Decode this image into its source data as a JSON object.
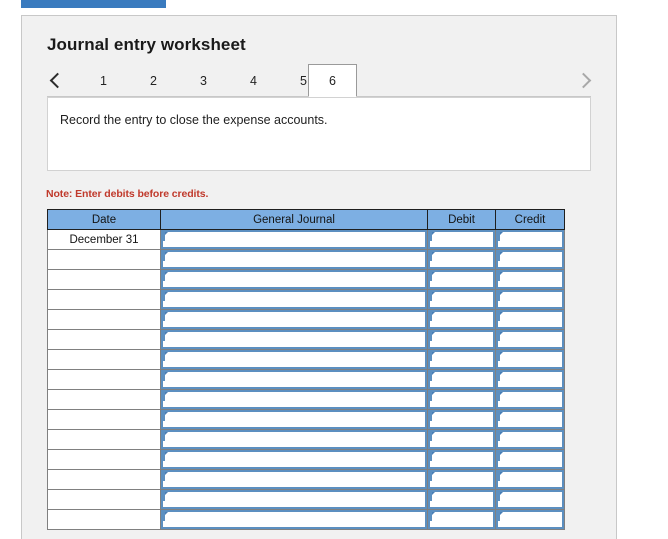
{
  "top_bar": {
    "color": "#3A7BBF"
  },
  "panel": {
    "title": "Journal entry worksheet",
    "bg": "#f1f1f1"
  },
  "tabs": {
    "prev_label": "previous",
    "next_label": "next",
    "items": [
      {
        "label": "1",
        "selected": false
      },
      {
        "label": "2",
        "selected": false
      },
      {
        "label": "3",
        "selected": false
      },
      {
        "label": "4",
        "selected": false
      },
      {
        "label": "5",
        "selected": false
      },
      {
        "label": "6",
        "selected": true
      }
    ]
  },
  "instruction": {
    "text": "Record the entry to close the expense accounts."
  },
  "note": {
    "text": "Note: Enter debits before credits.",
    "color": "#c0392b"
  },
  "table": {
    "header_color": "#7DAFE3",
    "columns": [
      {
        "key": "date",
        "label": "Date"
      },
      {
        "key": "general_journal",
        "label": "General Journal"
      },
      {
        "key": "debit",
        "label": "Debit"
      },
      {
        "key": "credit",
        "label": "Credit"
      }
    ],
    "rows": [
      {
        "date": "December 31",
        "general_journal": "",
        "debit": "",
        "credit": ""
      },
      {
        "date": "",
        "general_journal": "",
        "debit": "",
        "credit": ""
      },
      {
        "date": "",
        "general_journal": "",
        "debit": "",
        "credit": ""
      },
      {
        "date": "",
        "general_journal": "",
        "debit": "",
        "credit": ""
      },
      {
        "date": "",
        "general_journal": "",
        "debit": "",
        "credit": ""
      },
      {
        "date": "",
        "general_journal": "",
        "debit": "",
        "credit": ""
      },
      {
        "date": "",
        "general_journal": "",
        "debit": "",
        "credit": ""
      },
      {
        "date": "",
        "general_journal": "",
        "debit": "",
        "credit": ""
      },
      {
        "date": "",
        "general_journal": "",
        "debit": "",
        "credit": ""
      },
      {
        "date": "",
        "general_journal": "",
        "debit": "",
        "credit": ""
      },
      {
        "date": "",
        "general_journal": "",
        "debit": "",
        "credit": ""
      },
      {
        "date": "",
        "general_journal": "",
        "debit": "",
        "credit": ""
      },
      {
        "date": "",
        "general_journal": "",
        "debit": "",
        "credit": ""
      },
      {
        "date": "",
        "general_journal": "",
        "debit": "",
        "credit": ""
      },
      {
        "date": "",
        "general_journal": "",
        "debit": "",
        "credit": ""
      }
    ]
  }
}
